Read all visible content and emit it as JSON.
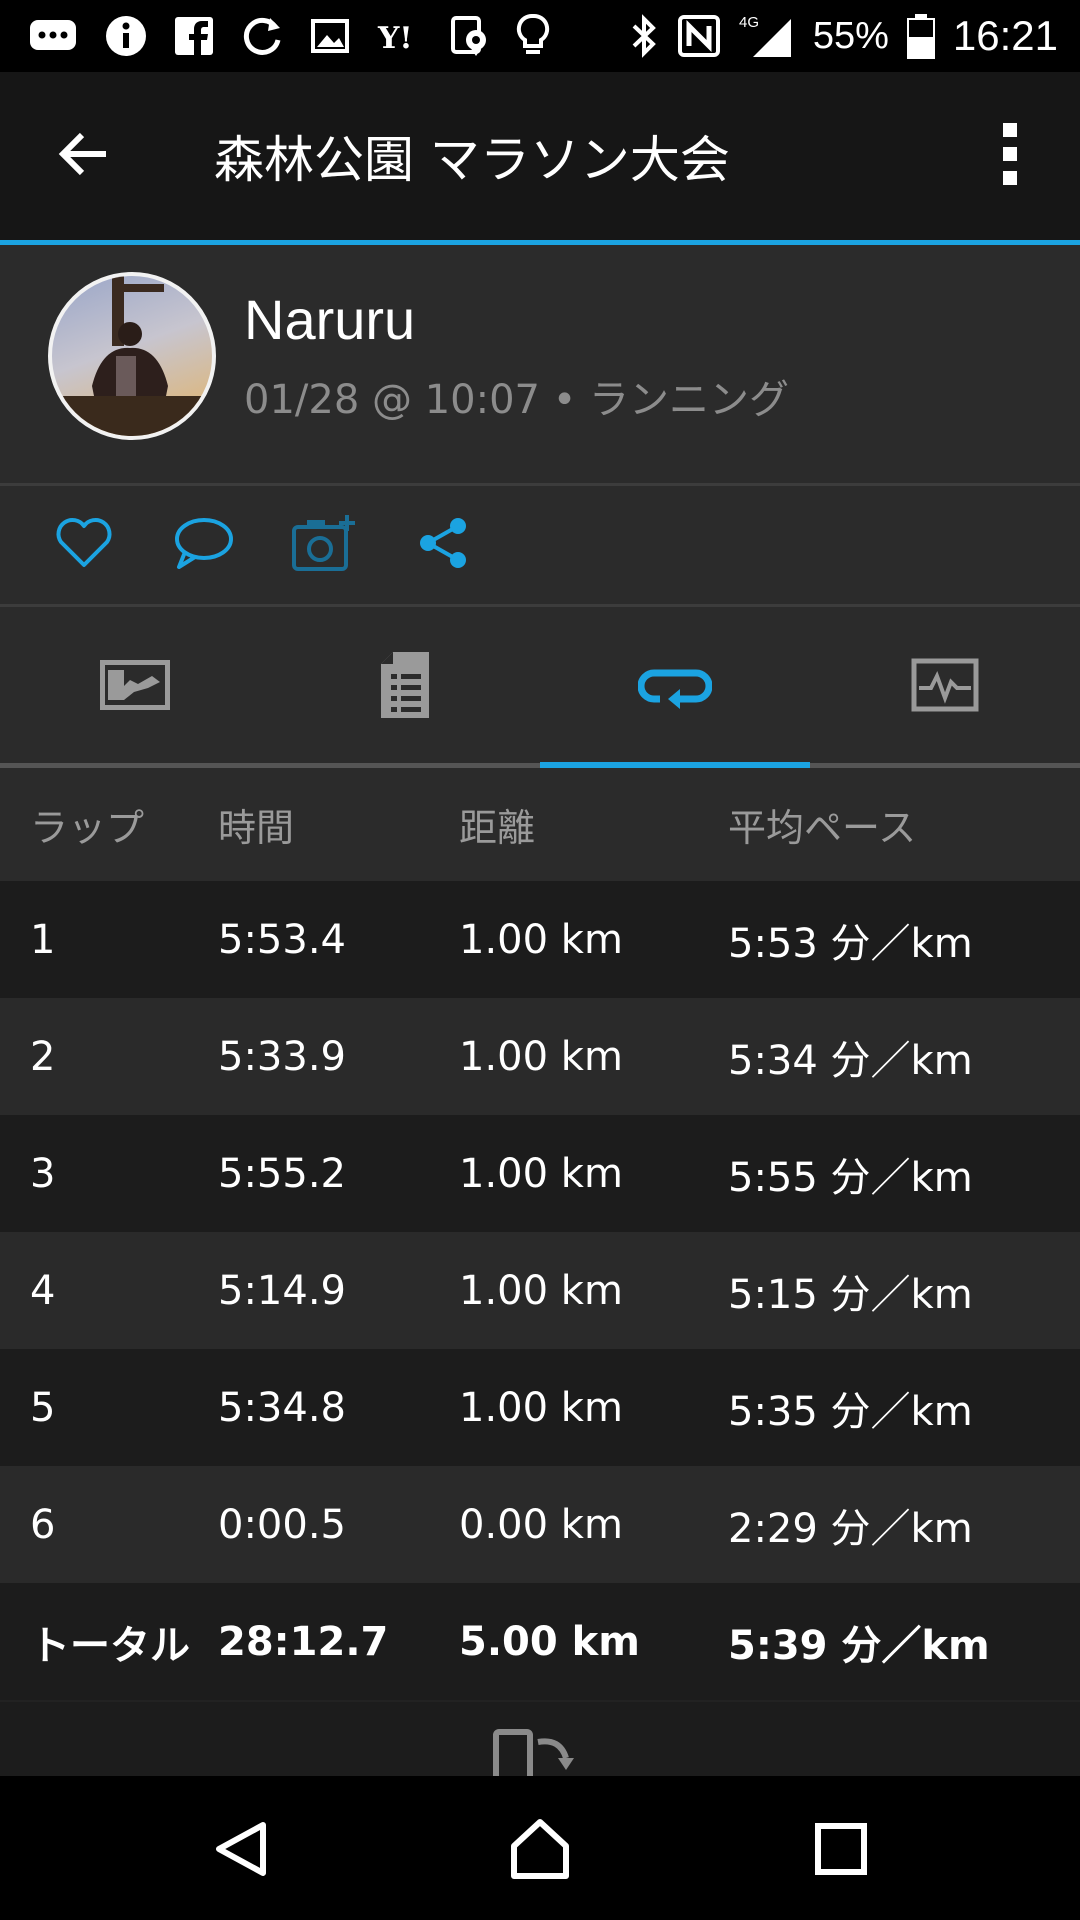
{
  "status_bar": {
    "left_icons": [
      "chat-icon",
      "info-icon",
      "facebook-icon",
      "sync-icon",
      "image-icon",
      "yahoo-icon",
      "location-icon",
      "lightbulb-icon"
    ],
    "right_icons": [
      "bluetooth-icon",
      "nfc-icon",
      "signal-icon"
    ],
    "network": "4G",
    "battery_percent": "55%",
    "time": "16:21"
  },
  "app_bar": {
    "title": "森林公園 マラソン大会",
    "back_icon": "arrow-left-icon",
    "menu_icon": "more-vert-icon"
  },
  "colors": {
    "accent": "#1ba3e1",
    "background": "#222222",
    "row_dark": "#1c1c1c",
    "row_light": "#2a2a2a"
  },
  "profile": {
    "name": "Naruru",
    "meta": "01/28 @ 10:07 • ランニング"
  },
  "actions": [
    "heart-icon",
    "comment-icon",
    "add-photo-icon",
    "share-icon"
  ],
  "tabs": [
    {
      "icon": "map-icon",
      "active": false
    },
    {
      "icon": "stats-icon",
      "active": false
    },
    {
      "icon": "laps-icon",
      "active": true
    },
    {
      "icon": "chart-icon",
      "active": false
    }
  ],
  "table": {
    "headers": [
      "ラップ",
      "時間",
      "距離",
      "平均ペース"
    ],
    "rows": [
      {
        "lap": "1",
        "time": "5:53.4",
        "distance": "1.00 km",
        "pace": "5:53 分／km"
      },
      {
        "lap": "2",
        "time": "5:33.9",
        "distance": "1.00 km",
        "pace": "5:34 分／km"
      },
      {
        "lap": "3",
        "time": "5:55.2",
        "distance": "1.00 km",
        "pace": "5:55 分／km"
      },
      {
        "lap": "4",
        "time": "5:14.9",
        "distance": "1.00 km",
        "pace": "5:15 分／km"
      },
      {
        "lap": "5",
        "time": "5:34.8",
        "distance": "1.00 km",
        "pace": "5:35 分／km"
      },
      {
        "lap": "6",
        "time": "0:00.5",
        "distance": "0.00 km",
        "pace": "2:29 分／km"
      }
    ],
    "total": {
      "lap": "トータル",
      "time": "28:12.7",
      "distance": "5.00 km",
      "pace": "5:39 分／km"
    }
  },
  "nav_bar": [
    "back-triangle-icon",
    "home-icon",
    "recents-icon"
  ]
}
